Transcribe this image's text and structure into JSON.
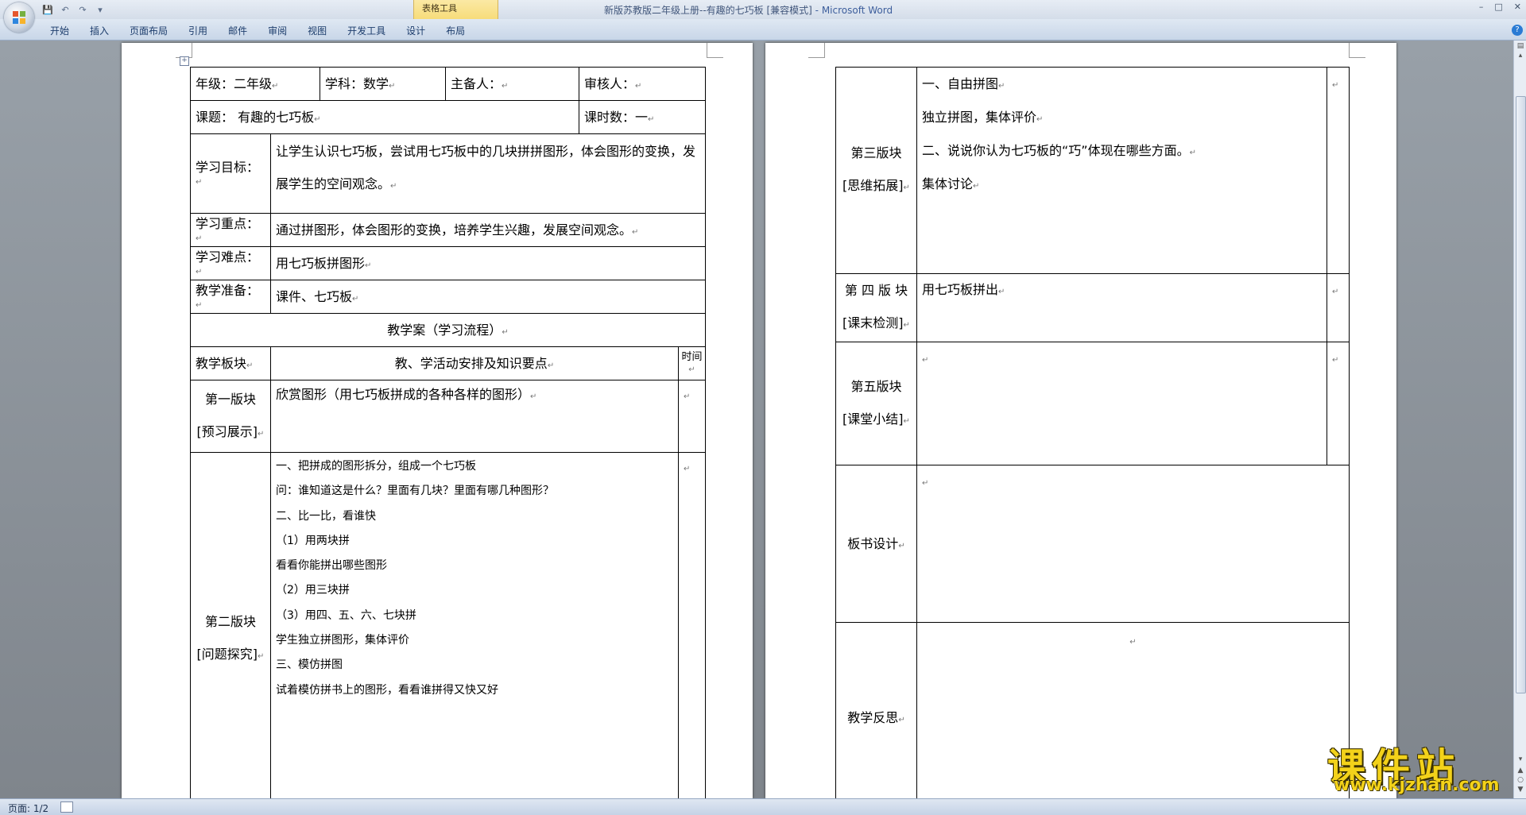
{
  "app": {
    "window_title": "新版苏教版二年级上册--有趣的七巧板 [兼容模式]",
    "app_name": "- Microsoft Word",
    "context_tab_group": "表格工具",
    "tabs": [
      "开始",
      "插入",
      "页面布局",
      "引用",
      "邮件",
      "审阅",
      "视图",
      "开发工具",
      "设计",
      "布局"
    ],
    "status_page": "页面: 1/2",
    "watermark_text": "课件站",
    "watermark_url": "www.kjzhan.com"
  },
  "page1": {
    "grade": "年级：二年级",
    "subject": "学科：数学",
    "preparer": "主备人：",
    "reviewer": "审核人：",
    "topic": "课题：  有趣的七巧板",
    "hours": "课时数：一",
    "goal_label": "学习目标：",
    "goal_text": "让学生认识七巧板，尝试用七巧板中的几块拼拼图形，体会图形的变换，发展学生的空间观念。",
    "key_label": "学习重点：",
    "key_text": "通过拼图形，体会图形的变换，培养学生兴趣，发展空间观念。",
    "difficulty_label": "学习难点：",
    "difficulty_text": "用七巧板拼图形",
    "prep_label": "教学准备：",
    "prep_text": "课件、七巧板",
    "flow_title": "教学案（学习流程）",
    "col_module": "教学板块",
    "col_activity": "教、学活动安排及知识要点",
    "col_time": "时间",
    "module1_name": "第一版块",
    "module1_sub": "[预习展示]",
    "module1_text": "欣赏图形（用七巧板拼成的各种各样的图形）",
    "module2_name": "第二版块",
    "module2_sub": "[问题探究]",
    "module2_lines": [
      "一、把拼成的图形拆分，组成一个七巧板",
      "问：谁知道这是什么？里面有几块？里面有哪几种图形？",
      "二、比一比，看谁快",
      "（1）用两块拼",
      "看看你能拼出哪些图形",
      "（2）用三块拼",
      "（3）用四、五、六、七块拼",
      "学生独立拼图形，集体评价",
      "三、模仿拼图",
      "试着模仿拼书上的图形，看看谁拼得又快又好"
    ]
  },
  "page2": {
    "module3_name": "第三版块",
    "module3_sub": "[思维拓展]",
    "module3_lines": [
      "一、自由拼图",
      "独立拼图，集体评价",
      "二、说说你认为七巧板的“巧”体现在哪些方面。",
      "集体讨论"
    ],
    "module4_name": "第 四 版 块",
    "module4_sub": "[课末检测]",
    "module4_text": "用七巧板拼出",
    "module5_name": "第五版块",
    "module5_sub": "[课堂小结]",
    "board_label": "板书设计",
    "reflection_label": "教学反思"
  }
}
